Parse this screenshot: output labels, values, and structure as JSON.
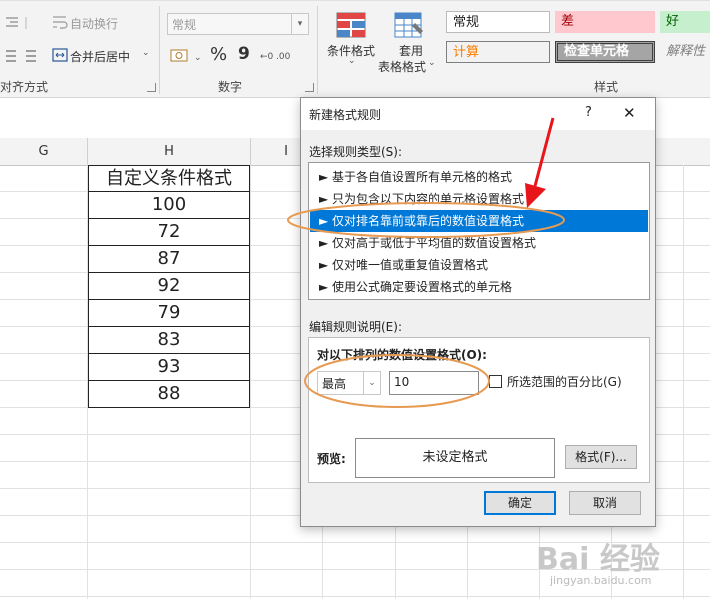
{
  "ribbon": {
    "wrap_text_label": "自动换行",
    "merge_center_label": "合并后居中",
    "alignment_group_label": "对齐方式",
    "number_format_value": "常规",
    "percent_symbol": "%",
    "comma_symbol": "9",
    "number_group_label": "数字",
    "conditional_format_label": "条件格式",
    "table_format_label_1": "套用",
    "table_format_label_2": "表格格式",
    "styles_group_label": "样式",
    "styles": {
      "normal": "常规",
      "bad": "差",
      "good": "好",
      "calculation": "计算",
      "check_cell": "检查单元格",
      "explanatory": "解释性"
    },
    "colors": {
      "bad_bg": "#ffc7ce",
      "bad_fg": "#9c0006",
      "good_bg": "#c6efce",
      "good_fg": "#006100",
      "calc_bg": "#f2f2f2",
      "calc_fg": "#fa7d00",
      "check_bg": "#a5a5a5"
    }
  },
  "sheet": {
    "columns": [
      "G",
      "H",
      "I"
    ],
    "header_cell": "自定义条件格式",
    "values": [
      "100",
      "72",
      "87",
      "92",
      "79",
      "83",
      "93",
      "88"
    ]
  },
  "dialog": {
    "title": "新建格式规则",
    "help": "?",
    "close": "✕",
    "rule_type_label": "选择规则类型(S):",
    "rule_types": [
      "► 基于各自值设置所有单元格的格式",
      "► 只为包含以下内容的单元格设置格式",
      "► 仅对排名靠前或靠后的数值设置格式",
      "► 仅对高于或低于平均值的数值设置格式",
      "► 仅对唯一值或重复值设置格式",
      "► 使用公式确定要设置格式的单元格"
    ],
    "selected_index": 2,
    "edit_label": "编辑规则说明(E):",
    "format_values_label": "对以下排列的数值设置格式(O):",
    "rank_select": "最高",
    "rank_count": "10",
    "percent_checkbox_label": "所选范围的百分比(G)",
    "preview_label": "预览:",
    "preview_text": "未设定格式",
    "format_button": "格式(F)...",
    "ok_button": "确定",
    "cancel_button": "取消",
    "accent_color": "#0078d7"
  },
  "annotations": {
    "arrow_color": "#e8161b",
    "ellipse_color": "#e69a52"
  },
  "watermark": {
    "logo_text": "Bai 经验",
    "site": "jingyan.baidu.com"
  }
}
